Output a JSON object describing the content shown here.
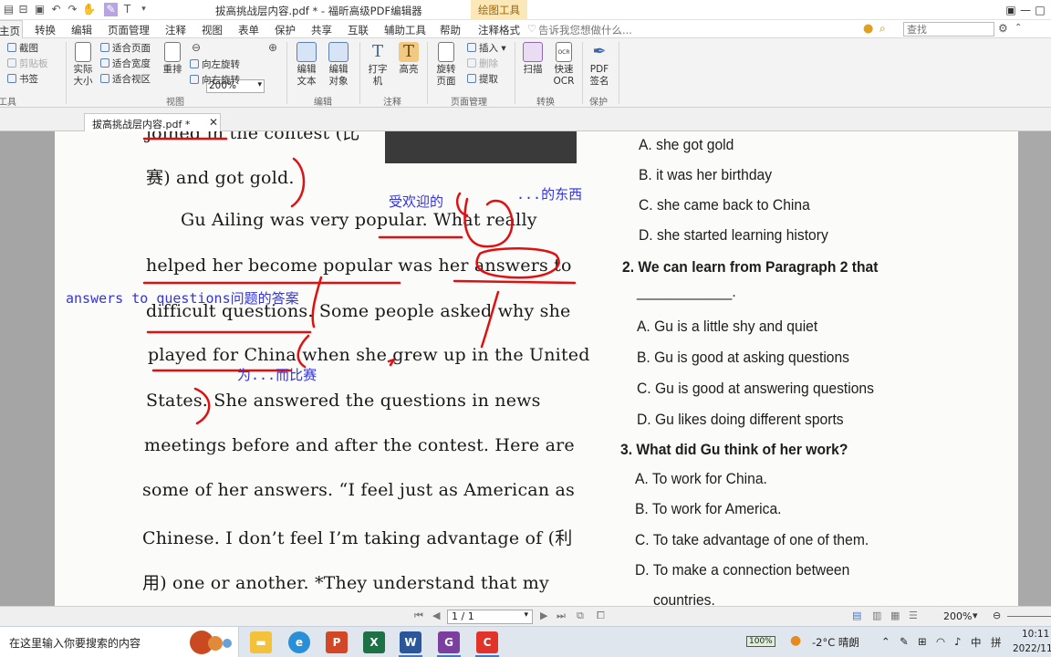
{
  "app": {
    "title": "拔高挑战层内容.pdf * - 福昕高级PDF编辑器",
    "context_tab": "绘图工具"
  },
  "menu": {
    "tabs": [
      "主页",
      "转换",
      "编辑",
      "页面管理",
      "注释",
      "视图",
      "表单",
      "保护",
      "共享",
      "互联",
      "辅助工具",
      "帮助",
      "注释格式"
    ],
    "tell_me": "告诉我您想做什么...",
    "search_placeholder": "查找"
  },
  "ribbon": {
    "tools": {
      "screenshot": "截图",
      "clipboard": "剪贴板",
      "bookmark": "书签",
      "label": "工具"
    },
    "view": {
      "actual_size": "实际大小",
      "fit_page": "适合页面",
      "fit_width": "适合宽度",
      "fit_visible": "适合视区",
      "reflow": "重排",
      "zoom": "200%",
      "rotate_left": "向左旋转",
      "rotate_right": "向右旋转",
      "label": "视图"
    },
    "edit": {
      "edit_text": "编辑文本",
      "edit_object": "编辑对象",
      "label": "编辑"
    },
    "comment": {
      "typewriter": "打字机",
      "highlight": "高亮",
      "label": "注释"
    },
    "page_mgmt": {
      "rotate_page": "旋转页面",
      "insert": "插入",
      "delete": "删除",
      "extract": "提取",
      "label": "页面管理"
    },
    "convert": {
      "scan": "扫描",
      "quick_ocr": "快速OCR",
      "label": "转换"
    },
    "protect": {
      "pdf_sign": "PDF签名",
      "label": "保护"
    }
  },
  "document_tab": {
    "name": "拔高挑战层内容.pdf *"
  },
  "passage": {
    "lines": [
      "joined in the contest (比",
      "赛) and got gold.",
      "Gu Ailing was very popular. What really",
      "helped her become popular was her answers to",
      "difficult questions. Some people asked why she",
      "played for China when she grew up in the United",
      "States. She answered the questions in news",
      "meetings before and after the contest. Here are",
      "some of her answers. “I feel just as American as",
      "Chinese. I don’t feel I’m taking advantage of (利",
      "用) one or another. *They understand that my"
    ]
  },
  "annotations": {
    "popular": "受欢迎的",
    "what": "...的东西",
    "answers_to": "answers to questions问题的答案",
    "play_for": "为...而比赛"
  },
  "questions": {
    "q1_options": [
      "A. she got gold",
      "B. it was her birthday",
      "C. she came back to China",
      "D. she started learning history"
    ],
    "q2": "2. We can learn from Paragraph 2 that",
    "q2_blank": "____________.",
    "q2_options": [
      "A. Gu is a little shy and quiet",
      "B. Gu is good at asking questions",
      "C. Gu is good at answering questions",
      "D. Gu likes doing different sports"
    ],
    "q3": "3. What did Gu think of her work?",
    "q3_options": [
      "A. To work for China.",
      "B. To work for America.",
      "C. To take advantage of one of them.",
      "D. To make a connection between"
    ],
    "q3_option_d_cont": "countries."
  },
  "statusbar": {
    "page": "1 / 1",
    "zoom": "200%"
  },
  "taskbar": {
    "search": "在这里输入你要搜索的内容",
    "battery": "100%",
    "weather": "-2°C 晴朗",
    "ime": "中",
    "ime2": "拼",
    "time": "10:11",
    "date": "2022/11"
  },
  "colors": {
    "ink": "#e01010",
    "annotation": "#3434d8",
    "context_tab_bg": "#fbe8b8",
    "active_task": "#3b78d8"
  }
}
